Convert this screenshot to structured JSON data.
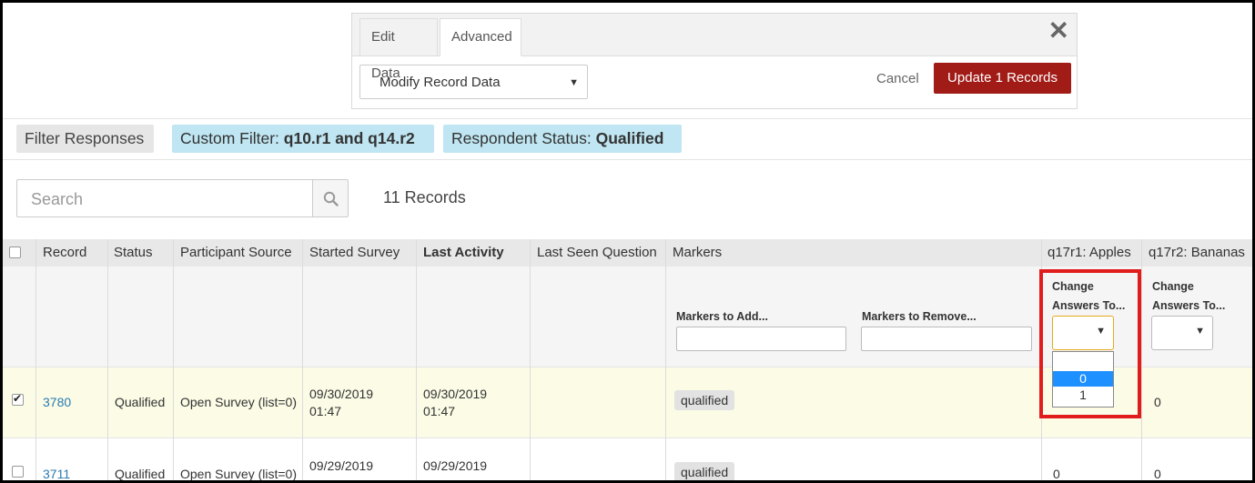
{
  "panel": {
    "tabs": [
      "Edit Data",
      "Advanced"
    ],
    "action_select": "Modify Record Data",
    "cancel": "Cancel",
    "update": "Update 1 Records"
  },
  "filters": {
    "filter_button": "Filter Responses",
    "custom_prefix": "Custom Filter: ",
    "custom_value": "q10.r1 and q14.r2",
    "status_prefix": "Respondent Status: ",
    "status_value": "Qualified"
  },
  "search": {
    "placeholder": "Search",
    "count": "11 Records"
  },
  "table": {
    "headers": [
      "Record",
      "Status",
      "Participant Source",
      "Started Survey",
      "Last Activity",
      "Last Seen Question",
      "Markers",
      "q17r1: Apples",
      "q17r2: Bananas"
    ],
    "markers_add_label": "Markers to Add...",
    "markers_remove_label": "Markers to Remove...",
    "change_line1": "Change",
    "change_line2": "Answers To...",
    "dropdown_options": [
      "",
      "0",
      "1"
    ],
    "rows": [
      {
        "record": "3780",
        "status": "Qualified",
        "source": "Open Survey (list=0)",
        "started_date": "09/30/2019",
        "started_time": "01:47",
        "last_date": "09/30/2019",
        "last_time": "01:47",
        "marker": "qualified",
        "q17r2": "0",
        "checked": true
      },
      {
        "record": "3711",
        "status": "Qualified",
        "source": "Open Survey (list=0)",
        "started_date": "09/29/2019",
        "last_date": "09/29/2019",
        "marker": "qualified",
        "q17r1": "0",
        "q17r2": "0",
        "checked": false
      }
    ]
  },
  "colors": {
    "update_button": "#a11b17",
    "chip_blue": "#bfe6f2",
    "highlight": "#e11c1c",
    "row_selected": "#fbfbe6",
    "link": "#2a7ab0"
  }
}
